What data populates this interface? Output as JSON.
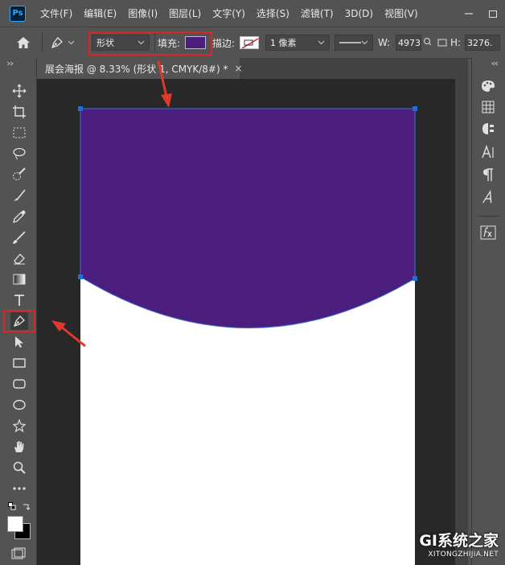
{
  "app": {
    "logo_text": "Ps"
  },
  "menu": [
    "文件(F)",
    "编辑(E)",
    "图像(I)",
    "图层(L)",
    "文字(Y)",
    "选择(S)",
    "滤镜(T)",
    "3D(D)",
    "视图(V)"
  ],
  "options": {
    "mode_value": "形状",
    "fill_label": "填充:",
    "fill_color": "#4b1d7d",
    "stroke_label": "描边:",
    "stroke_width_value": "1 像素",
    "width_label": "W:",
    "width_value": "4973",
    "height_label": "H:",
    "height_value": "3276."
  },
  "document": {
    "tab_title": "展会海报 @ 8.33% (形状 1, CMYK/8#) *",
    "close_glyph": "×",
    "shape_color": "#4b1d7d"
  },
  "watermark": {
    "brand": "GI系统之家",
    "url": "XITONGZHIJIA.NET"
  },
  "colors": {
    "accent_highlight": "#d9262b",
    "arrow": "#e0382b",
    "anchor": "#1f6fd6"
  }
}
